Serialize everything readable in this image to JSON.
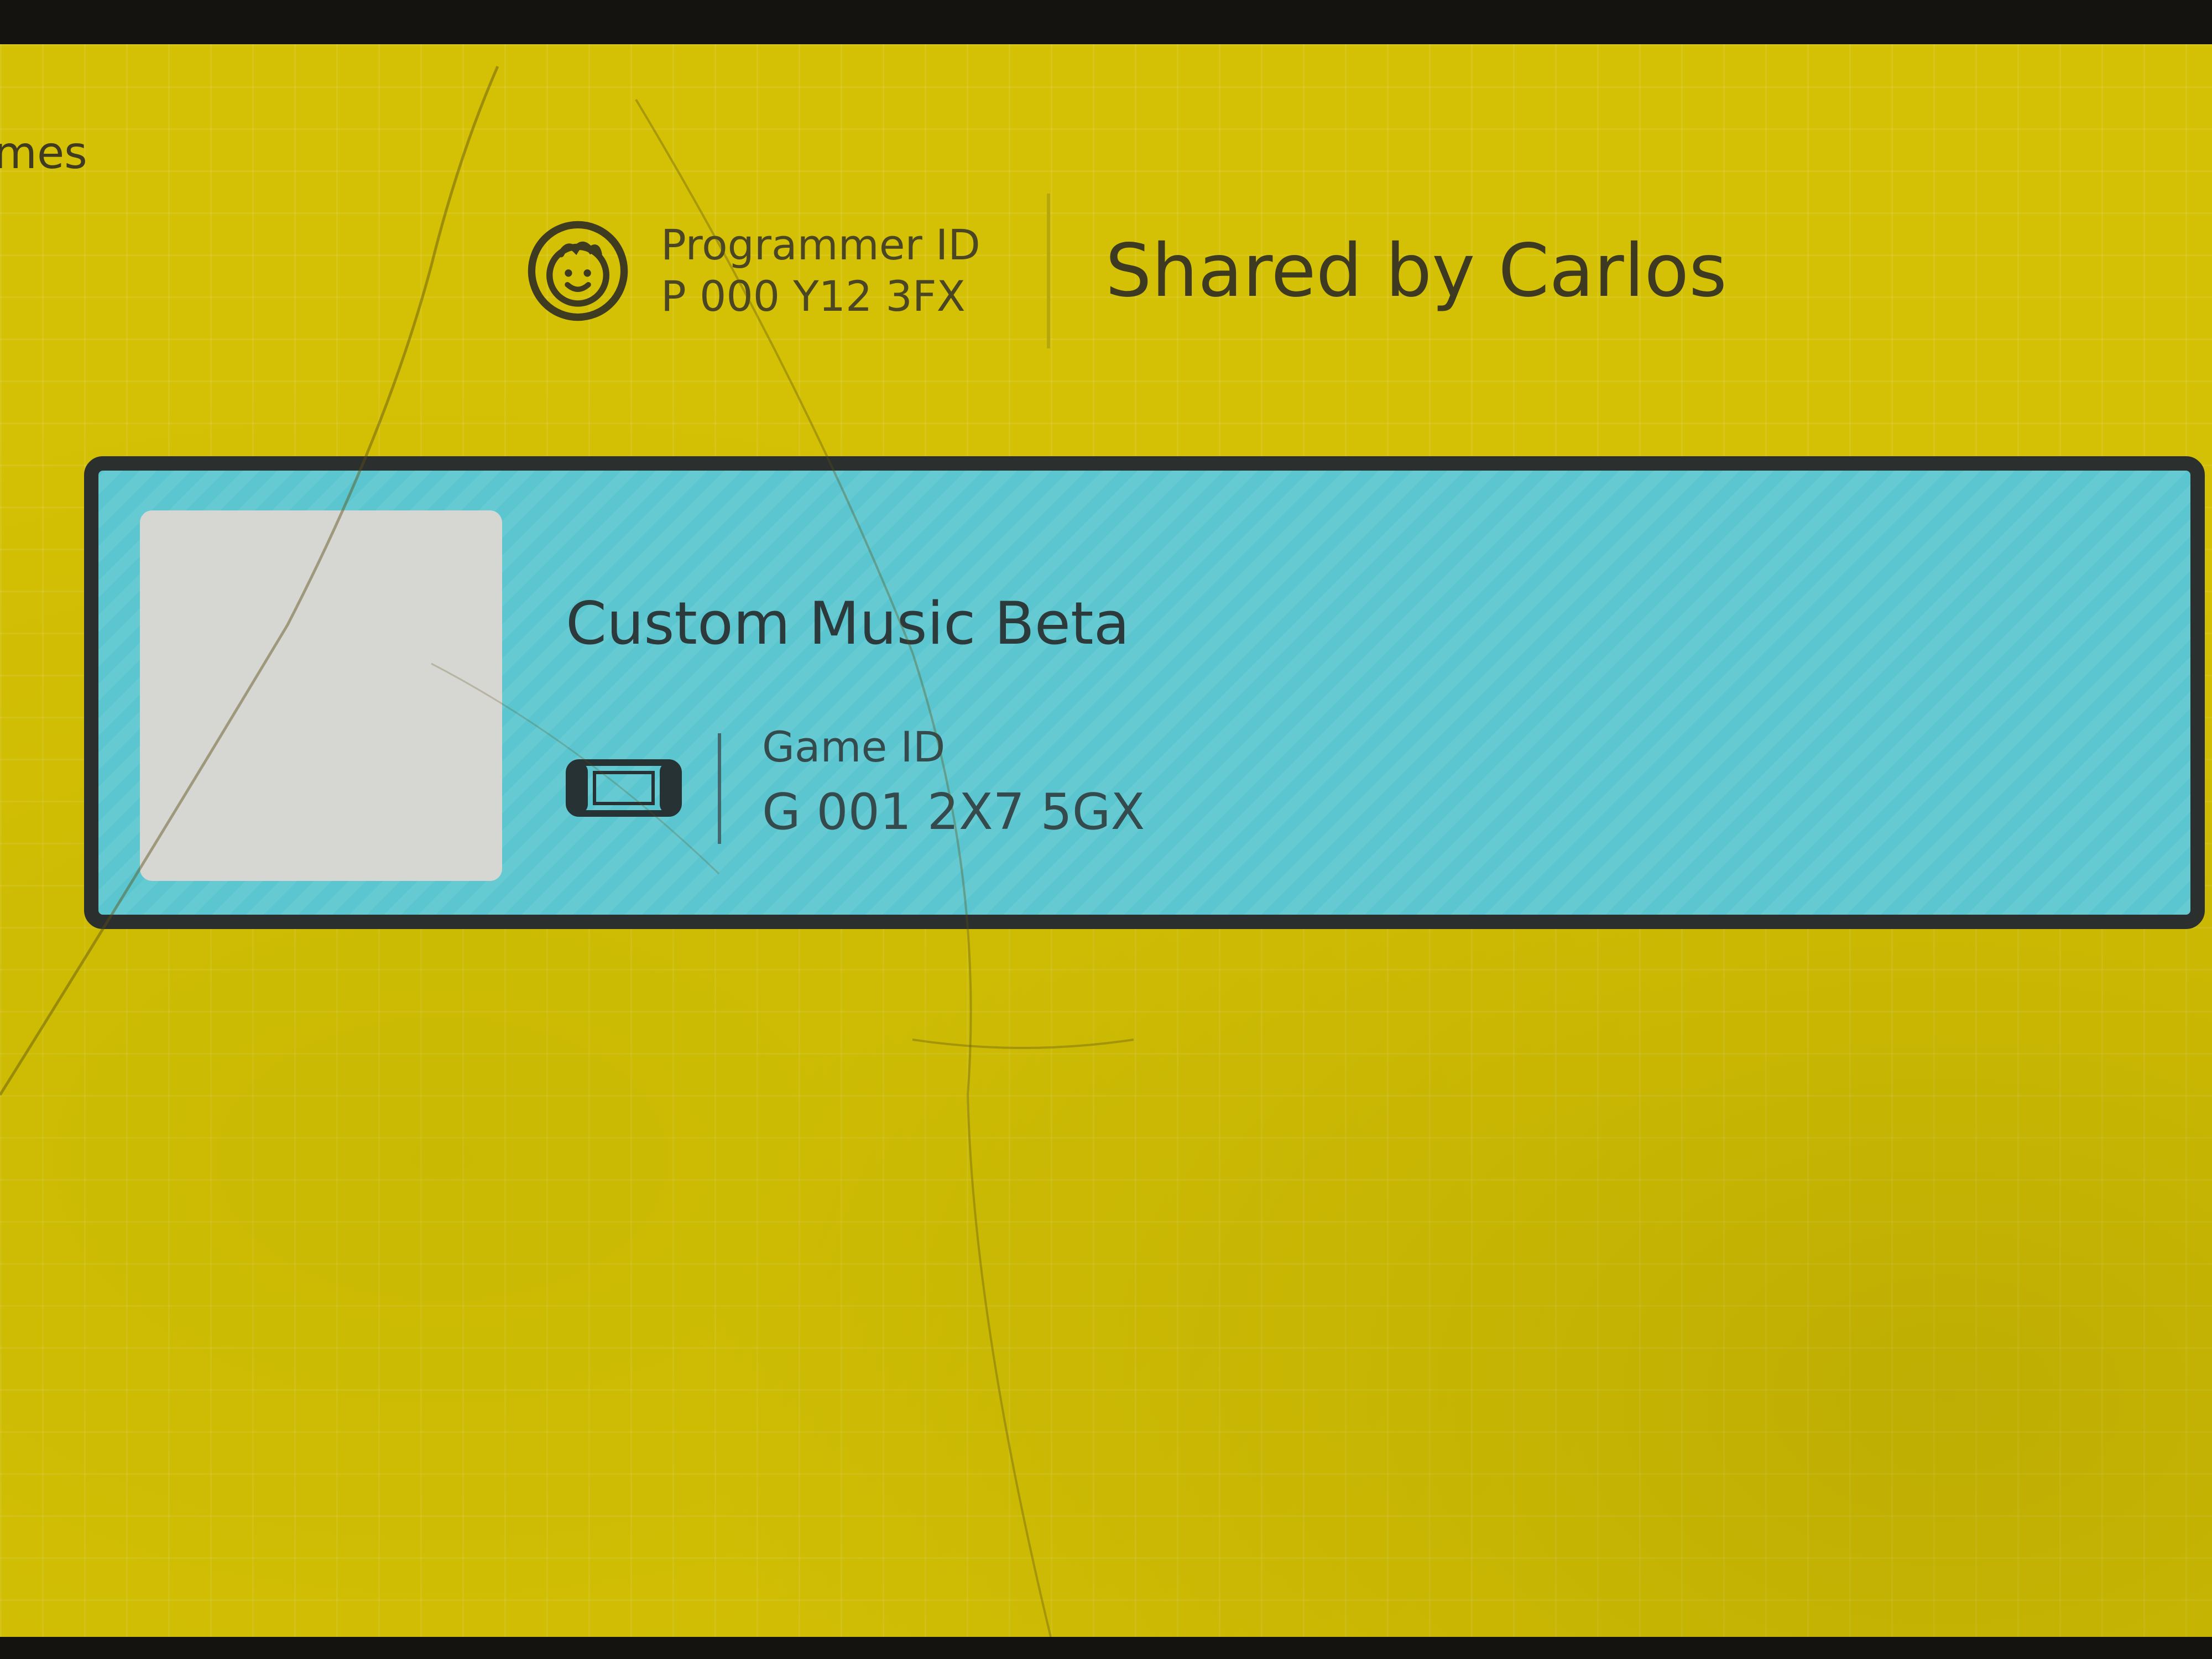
{
  "nav": {
    "back_label": "ames"
  },
  "header": {
    "programmer_id_label": "Programmer ID",
    "programmer_id": "P 000 Y12 3FX",
    "shared_title": "Shared by Carlos",
    "icon": "smiley-face-icon"
  },
  "games": [
    {
      "title": "Custom Music Beta",
      "game_id_label": "Game ID",
      "game_id": "G 001 2X7 5GX",
      "icon": "handheld-console-icon"
    }
  ],
  "colors": {
    "background": "#d4c004",
    "card": "#5bc6cf",
    "card_border": "#2b2f2e",
    "text": "#3a3624"
  }
}
